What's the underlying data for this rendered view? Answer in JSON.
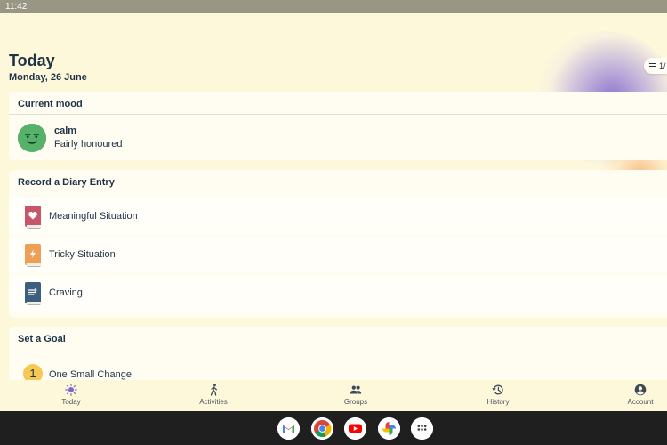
{
  "status_bar": {
    "time": "11:42"
  },
  "header": {
    "title": "Today",
    "date": "Monday, 26 June"
  },
  "pill": {
    "icon": "list-icon",
    "text": "1/"
  },
  "mood_card": {
    "heading": "Current mood",
    "mood": "calm",
    "detail": "Fairly honoured",
    "face_color": "#56b26a"
  },
  "diary_card": {
    "heading": "Record a Diary Entry",
    "items": [
      {
        "label": "Meaningful Situation",
        "icon": "heart-book-icon",
        "color": "#c7566a"
      },
      {
        "label": "Tricky Situation",
        "icon": "lightning-book-icon",
        "color": "#eda055"
      },
      {
        "label": "Craving",
        "icon": "craving-book-icon",
        "color": "#3e5e7e"
      }
    ]
  },
  "goal_card": {
    "heading": "Set a Goal",
    "items": [
      {
        "number": "1",
        "label": "One Small Change"
      }
    ]
  },
  "nav": {
    "items": [
      {
        "label": "Today",
        "icon": "sun-icon"
      },
      {
        "label": "Activities",
        "icon": "walking-icon"
      },
      {
        "label": "Groups",
        "icon": "people-icon"
      },
      {
        "label": "History",
        "icon": "history-icon"
      },
      {
        "label": "Account",
        "icon": "account-icon"
      }
    ]
  },
  "taskbar": {
    "apps": [
      "gmail-icon",
      "chrome-icon",
      "youtube-icon",
      "photos-icon",
      "app-launcher-icon"
    ]
  }
}
